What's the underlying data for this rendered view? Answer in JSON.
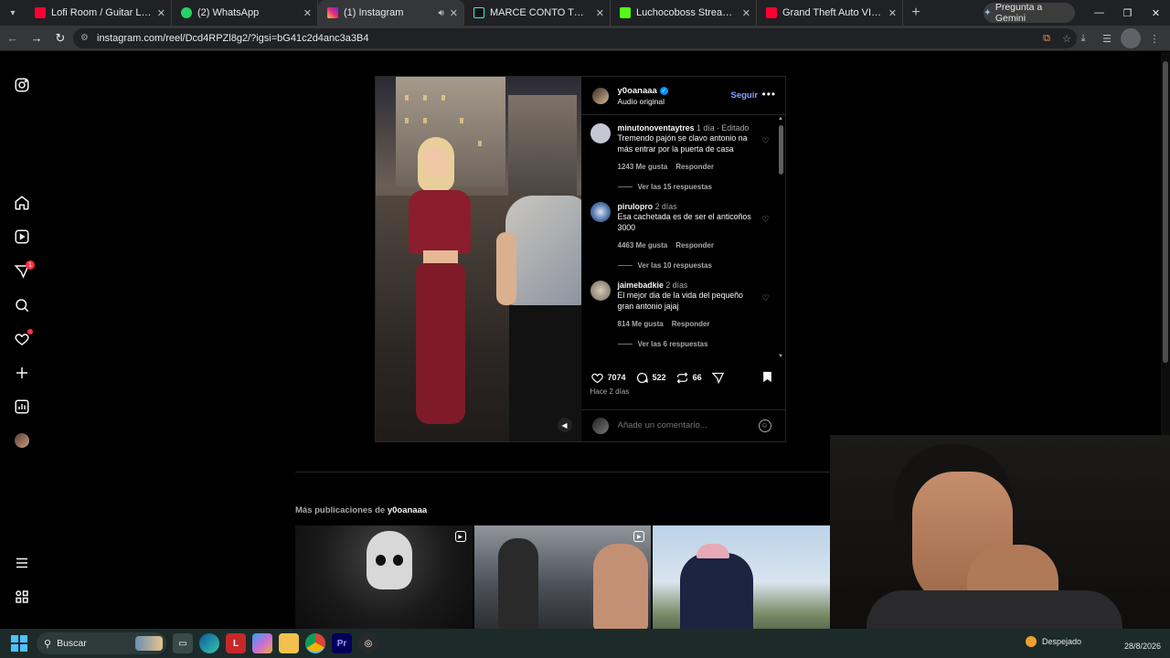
{
  "browser": {
    "tabs": [
      {
        "title": "Lofi Room / Guitar Lofi / C",
        "favicon_color": "#ff0033",
        "active": false
      },
      {
        "title": "(2) WhatsApp",
        "favicon_color": "#25d366",
        "active": false
      },
      {
        "title": "(1) Instagram",
        "favicon_color": "#e1306c",
        "active": true
      },
      {
        "title": "MARCE CONTO TODO SOBRE E",
        "favicon_color": "#000000",
        "active": false
      },
      {
        "title": "Luchocoboss Stream - Watch L",
        "favicon_color": "#53fc18",
        "active": false
      },
      {
        "title": "Grand Theft Auto VI: An Extend",
        "favicon_color": "#ff0033",
        "active": false
      }
    ],
    "gemini_label": "Pregunta a Gemini",
    "url": "instagram.com/reel/Dcd4RPZl8g2/?igsi=bG41c2d4anc3a3B4"
  },
  "sidebar": {
    "notification_count": "1"
  },
  "post": {
    "username": "y0oanaaa",
    "audio": "Audio original",
    "follow_label": "Seguir",
    "comments": [
      {
        "user": "minutonoventaytres",
        "time": "1 día · Editado",
        "text": "Tremendo pajón se clavo antonio na más entrar por la puerta de casa",
        "likes": "1243 Me gusta",
        "reply_label": "Responder",
        "replies": "Ver las 15 respuestas",
        "avatar_color": "#c4c8d2"
      },
      {
        "user": "pirulopro",
        "time": "2 días",
        "text": "Esa cachetada es de ser el anticoños 3000",
        "likes": "4463 Me gusta",
        "reply_label": "Responder",
        "replies": "Ver las 10 respuestas",
        "avatar_color": "#4a6fa5"
      },
      {
        "user": "jaimebadkie",
        "time": "2 días",
        "text": "El mejor dia de la vida del pequeño gran antonio jajaj",
        "likes": "814 Me gusta",
        "reply_label": "Responder",
        "replies": "Ver las 6 respuestas",
        "avatar_color": "#8d8576"
      }
    ],
    "likes": "7074",
    "comment_count": "522",
    "reposts": "66",
    "posted_ago": "Hace 2 días",
    "add_comment_placeholder": "Añade un comentario..."
  },
  "more_posts": {
    "label": "Más publicaciones de ",
    "username": "y0oanaaa"
  },
  "taskbar": {
    "search_label": "Buscar",
    "weather": "Despejado",
    "date": "28/8/2026"
  }
}
